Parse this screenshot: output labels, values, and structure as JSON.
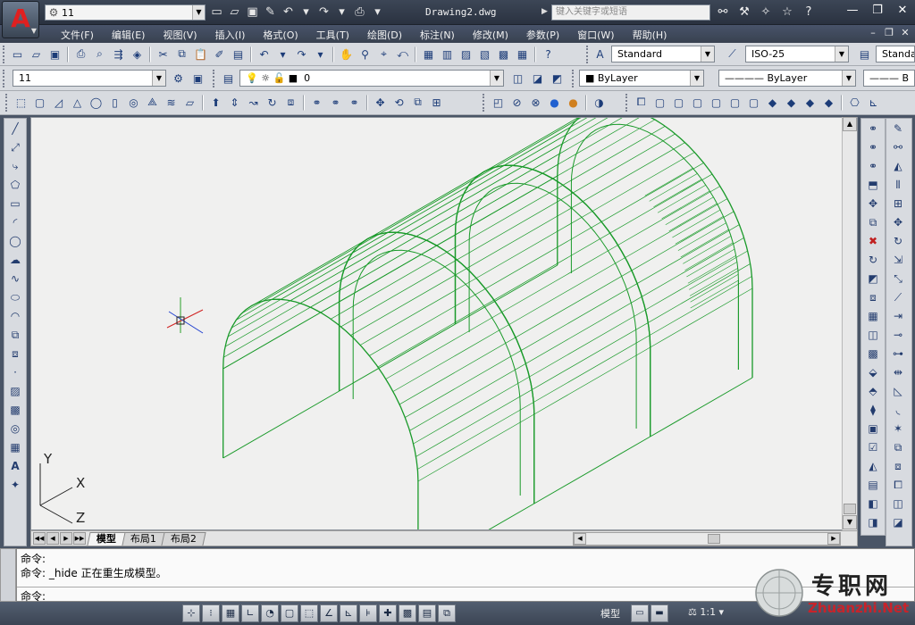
{
  "title_bar": {
    "workspace": "11",
    "document_title": "Drawing2.dwg",
    "search_placeholder": "键入关键字或短语"
  },
  "menu": {
    "items": [
      "文件(F)",
      "编辑(E)",
      "视图(V)",
      "插入(I)",
      "格式(O)",
      "工具(T)",
      "绘图(D)",
      "标注(N)",
      "修改(M)",
      "参数(P)",
      "窗口(W)",
      "帮助(H)"
    ]
  },
  "styles_toolbar": {
    "text_style": "Standard",
    "dim_style": "ISO-25",
    "table_style": "Standa"
  },
  "layers_toolbar": {
    "workspace": "11",
    "layer": "0",
    "color": "ByLayer",
    "linetype": "ByLayer",
    "lineweight": "B"
  },
  "ucs_icon": {
    "y_label": "Y",
    "x_label": "X",
    "z_label": "Z"
  },
  "layout_tabs": [
    "模型",
    "布局1",
    "布局2"
  ],
  "command_history": [
    "命令:",
    "命令: _hide 正在重生成模型。"
  ],
  "command_prompt": "命令:",
  "status_bar": {
    "model_label": "模型",
    "scale": "1:1"
  },
  "watermark": {
    "cn": "专职网",
    "en": "Zhuanzhi.Net"
  },
  "colors": {
    "wireframe": "#1a9a2a",
    "canvas": "#f0f0ef",
    "title_bar": "#2f3846"
  }
}
